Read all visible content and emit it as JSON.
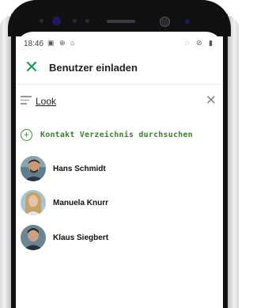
{
  "status_bar": {
    "time": "18:46",
    "left_icons": "▣ ⊕ ⌂",
    "right_icons": "◌ ⊘ ▮"
  },
  "app_bar": {
    "title": "Benutzer einladen"
  },
  "search": {
    "value": "Look"
  },
  "action": {
    "label": "Kontakt Verzeichnis durchsuchen"
  },
  "contacts": [
    {
      "name": "Hans Schmidt"
    },
    {
      "name": "Manuela Knurr"
    },
    {
      "name": "Klaus Siegbert"
    }
  ],
  "colors": {
    "accent_green": "#1f9a5a",
    "action_green": "#3f7d33"
  }
}
